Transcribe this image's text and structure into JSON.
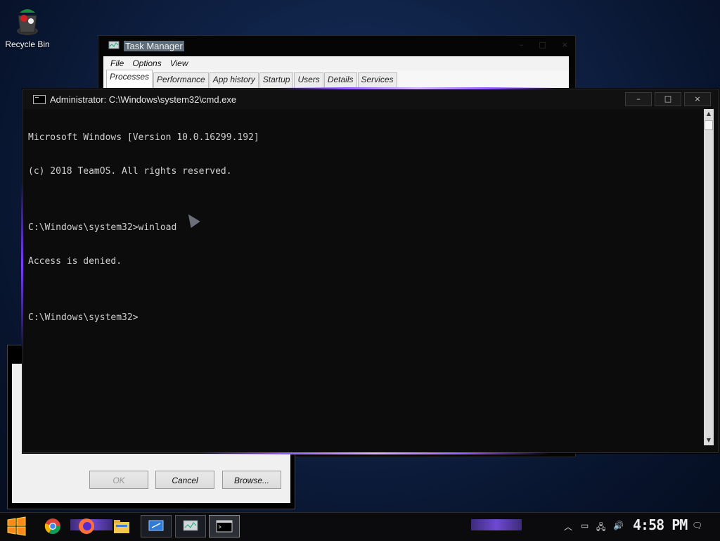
{
  "desktop": {
    "icon_label": "Recycle Bin"
  },
  "task_manager": {
    "title": "Task Manager",
    "menu": [
      "File",
      "Options",
      "View"
    ],
    "tabs": [
      "Processes",
      "Performance",
      "App history",
      "Startup",
      "Users",
      "Details",
      "Services"
    ],
    "active_tab": "Processes"
  },
  "dialog": {
    "buttons": {
      "ok": "OK",
      "cancel": "Cancel",
      "browse": "Browse..."
    }
  },
  "cmd": {
    "title": "Administrator: C:\\Windows\\system32\\cmd.exe",
    "lines": [
      "Microsoft Windows [Version 10.0.16299.192]",
      "(c) 2018 TeamOS. All rights reserved.",
      "",
      "C:\\Windows\\system32>winload",
      "Access is denied.",
      "",
      "C:\\Windows\\system32>"
    ]
  },
  "taskbar": {
    "apps": [
      "start-icon",
      "chrome-icon",
      "firefox-icon",
      "file-explorer-icon",
      "remote-desktop-icon",
      "task-manager-icon",
      "cmd-icon"
    ],
    "clock": "4:58 PM",
    "tray_icons": [
      "chevron-up-icon",
      "tablet-icon",
      "network-icon",
      "volume-icon",
      "notification-icon"
    ]
  }
}
